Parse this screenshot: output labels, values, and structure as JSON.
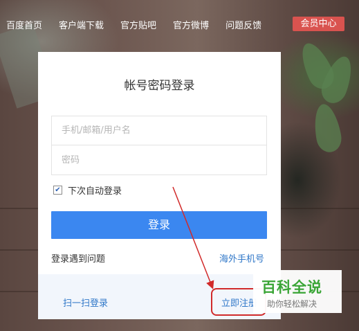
{
  "nav": {
    "items": [
      "百度首页",
      "客户端下载",
      "官方贴吧",
      "官方微博",
      "问题反馈"
    ],
    "vip_label": "会员中心"
  },
  "login": {
    "title": "帐号密码登录",
    "username_placeholder": "手机/邮箱/用户名",
    "password_placeholder": "密码",
    "remember_label": "下次自动登录",
    "remember_checked": true,
    "login_button": "登录",
    "trouble_link": "登录遇到问题",
    "overseas_link": "海外手机号",
    "scan_link": "扫一扫登录",
    "register_link": "立即注册"
  },
  "watermark": {
    "title": "百科全说",
    "subtitle": "助你轻松解决"
  },
  "colors": {
    "accent_blue": "#3b87f0",
    "link_blue": "#2f77c8",
    "vip_red": "#d9534f",
    "annotation_red": "#d12a2a",
    "watermark_green": "#3aa536"
  }
}
